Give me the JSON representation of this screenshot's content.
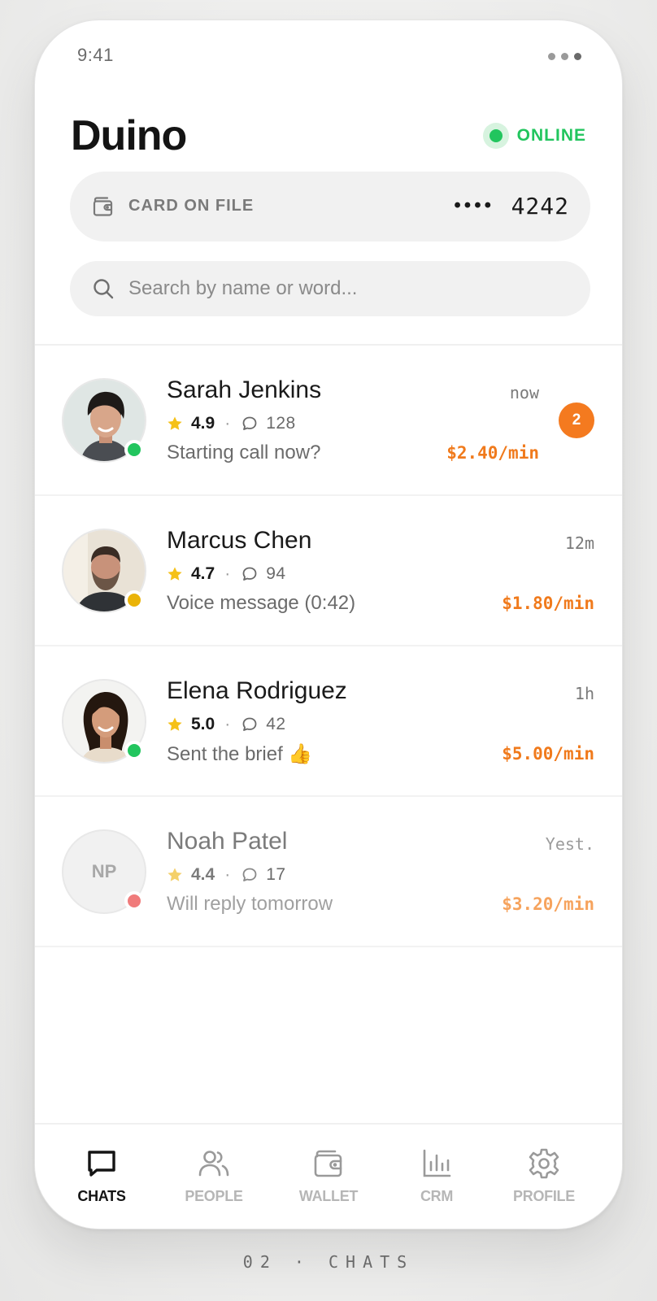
{
  "status_bar": {
    "time": "9:41"
  },
  "header": {
    "title": "Duino",
    "status_label": "ONLINE"
  },
  "card": {
    "label": "CARD ON FILE",
    "mask": "••••",
    "last4": "4242"
  },
  "search": {
    "placeholder": "Search by name or word..."
  },
  "chats": [
    {
      "name": "Sarah Jenkins",
      "rating": "4.9",
      "messages": "128",
      "preview": "Starting call now?",
      "time": "now",
      "rate": "$2.40/min",
      "unread": "2",
      "presence": "online",
      "presence_color": "#22c55e"
    },
    {
      "name": "Marcus Chen",
      "rating": "4.7",
      "messages": "94",
      "preview": "Voice message (0:42)",
      "time": "12m",
      "rate": "$1.80/min",
      "presence": "away",
      "presence_color": "#eab308"
    },
    {
      "name": "Elena Rodriguez",
      "rating": "5.0",
      "messages": "42",
      "preview": "Sent the brief 👍",
      "time": "1h",
      "rate": "$5.00/min",
      "presence": "online",
      "presence_color": "#22c55e"
    },
    {
      "name": "Noah Patel",
      "initials": "NP",
      "rating": "4.4",
      "messages": "17",
      "preview": "Will reply tomorrow",
      "time": "Yest.",
      "rate": "$3.20/min",
      "presence": "offline",
      "presence_color": "#f07b7b"
    }
  ],
  "tabs": [
    {
      "label": "CHATS",
      "icon": "chat-bubble-icon",
      "active": true
    },
    {
      "label": "PEOPLE",
      "icon": "people-icon",
      "active": false
    },
    {
      "label": "WALLET",
      "icon": "wallet-icon",
      "active": false
    },
    {
      "label": "CRM",
      "icon": "bar-chart-icon",
      "active": false
    },
    {
      "label": "PROFILE",
      "icon": "gear-icon",
      "active": false
    }
  ],
  "caption": "02 · CHATS",
  "colors": {
    "accent": "#f47a1f",
    "online": "#22c55e",
    "away": "#eab308",
    "offline": "#f07b7b"
  }
}
